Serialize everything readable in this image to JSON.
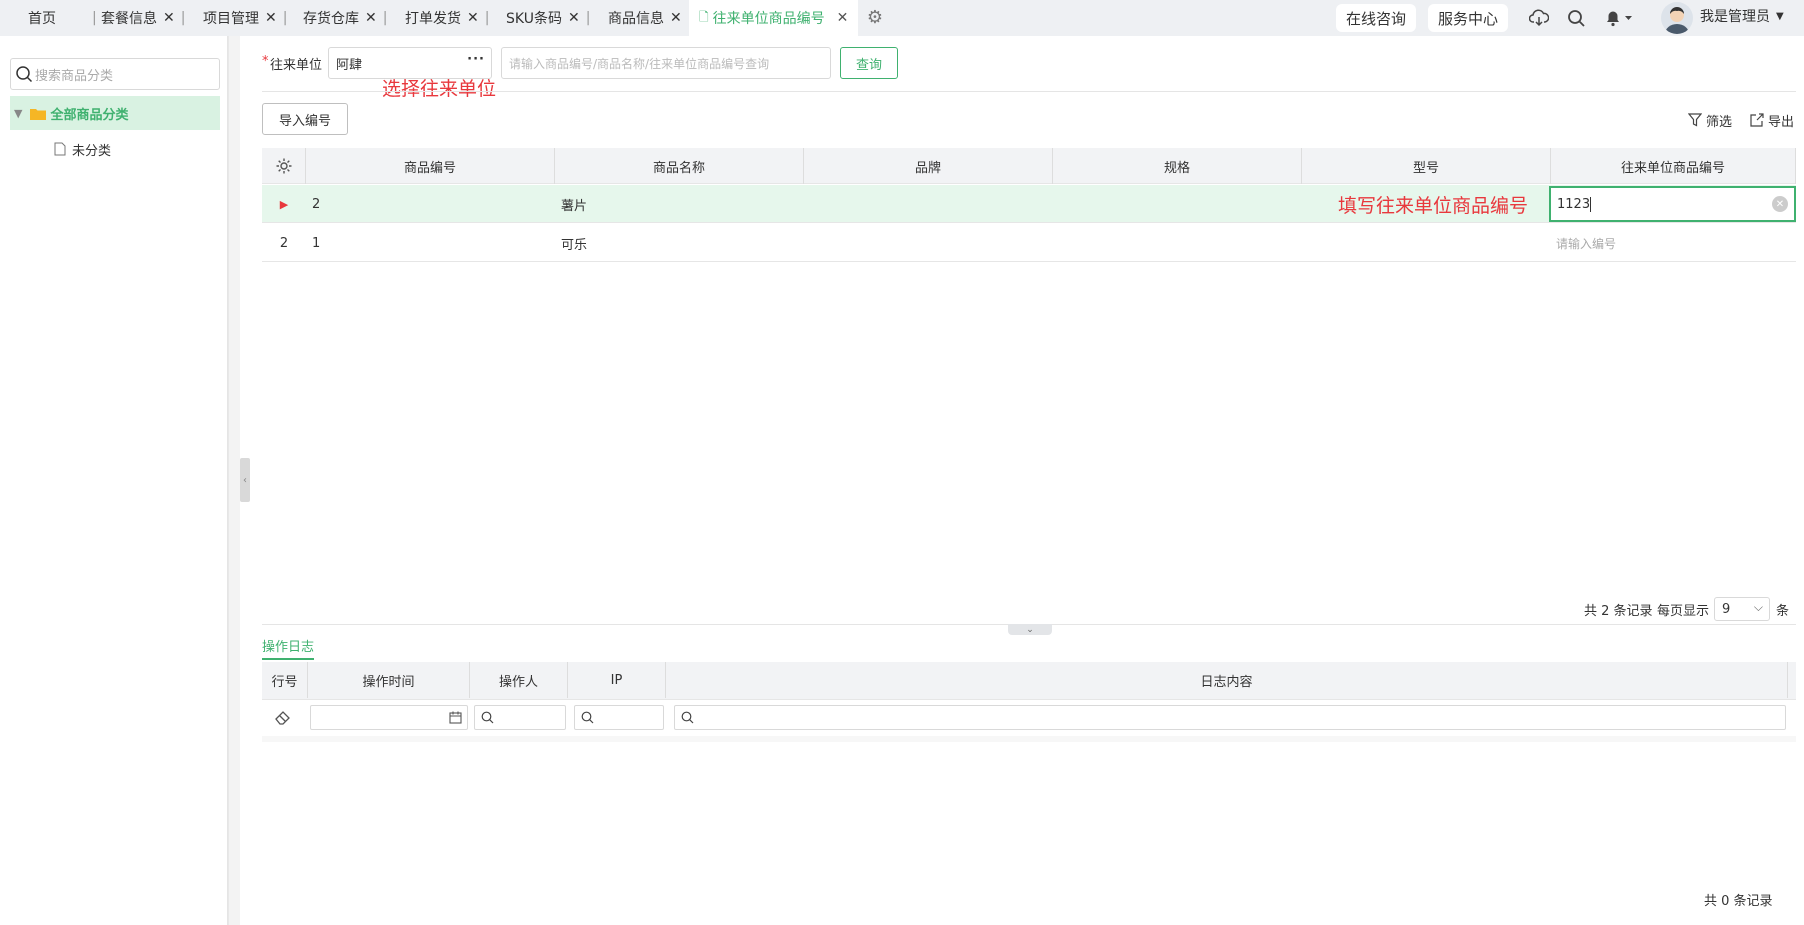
{
  "tabs": [
    {
      "label": "首页",
      "closable": false
    },
    {
      "label": "套餐信息",
      "closable": true
    },
    {
      "label": "项目管理",
      "closable": true
    },
    {
      "label": "存货仓库",
      "closable": true
    },
    {
      "label": "打单发货",
      "closable": true
    },
    {
      "label": "SKU条码",
      "closable": true
    },
    {
      "label": "商品信息",
      "closable": true
    },
    {
      "label": "往来单位商品编号",
      "closable": true,
      "active": true
    }
  ],
  "header": {
    "online_consult": "在线咨询",
    "service_center": "服务中心",
    "user_name": "我是管理员",
    "icons": [
      "cloud-download-icon",
      "search-icon",
      "bell-icon",
      "avatar",
      "settings-gear-icon"
    ]
  },
  "sidebar": {
    "search_placeholder": "搜索商品分类",
    "tree_root": "全部商品分类",
    "tree_child": "未分类"
  },
  "query": {
    "partner_label": "往来单位",
    "required_mark": "*",
    "partner_value": "阿肆",
    "search_placeholder": "请输入商品编号/商品名称/往来单位商品编号查询",
    "query_button": "查询",
    "annotation_partner": "选择往来单位"
  },
  "toolbar": {
    "import_button": "导入编号",
    "filter_label": "筛选",
    "export_label": "导出"
  },
  "grid": {
    "columns": [
      "商品编号",
      "商品名称",
      "品牌",
      "规格",
      "型号",
      "往来单位商品编号"
    ],
    "rows": [
      {
        "index": "▶",
        "code": "2",
        "name": "薯片",
        "brand": "",
        "spec": "",
        "model": "",
        "partner_code": "1123",
        "editing": true
      },
      {
        "index": "2",
        "code": "1",
        "name": "可乐",
        "brand": "",
        "spec": "",
        "model": "",
        "partner_code": "",
        "placeholder": "请输入编号"
      }
    ],
    "annotation_fill": "填写往来单位商品编号"
  },
  "pager": {
    "total_text": "共 2 条记录",
    "per_page_label": "每页显示",
    "per_page_value": "9",
    "unit": "条"
  },
  "log": {
    "tab_label": "操作日志",
    "columns": [
      "行号",
      "操作时间",
      "操作人",
      "IP",
      "日志内容"
    ],
    "total_text": "共 0 条记录"
  },
  "colors": {
    "accent": "#3fb16f",
    "annotation": "#e8383d",
    "selected_row": "#e6f7ec",
    "header_bg": "#f2f3f5"
  }
}
